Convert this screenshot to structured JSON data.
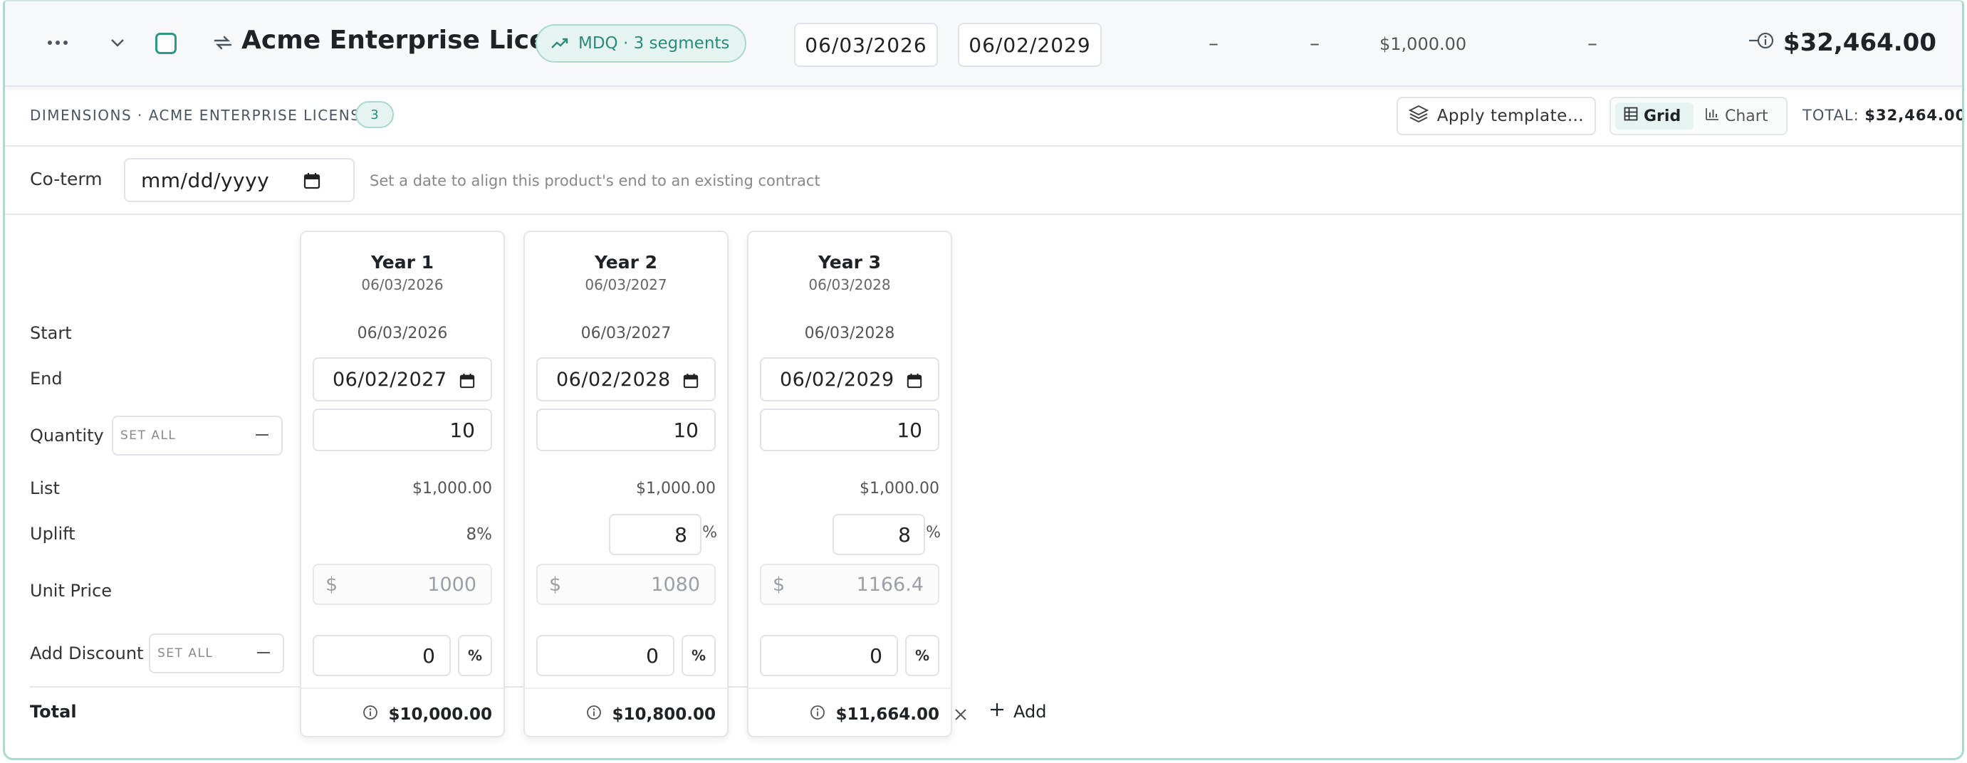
{
  "header": {
    "product_name": "Acme Enterprise License",
    "pill_label": "MDQ · 3 segments",
    "start_date": "06/03/2026",
    "end_date": "06/02/2029",
    "col_dash_1": "–",
    "col_dash_2": "–",
    "list_price": "$1,000.00",
    "col_dash_3": "–",
    "total": "$32,464.00",
    "icons": [
      "more-horizontal-icon",
      "chevron-down-icon",
      "repeat-icon",
      "trending-up-icon",
      "info-icon"
    ]
  },
  "dimensions": {
    "label": "DIMENSIONS · ACME ENTERPRISE LICENSE",
    "count": "3",
    "apply_template": "Apply template…",
    "view_grid": "Grid",
    "view_chart": "Chart",
    "active_view": "Grid",
    "total_label": "TOTAL:",
    "total_value": "$32,464.00"
  },
  "coterm": {
    "label": "Co-term",
    "placeholder": "mm/dd/yyyy",
    "hint": "Set a date to align this product's end to an existing contract"
  },
  "rows": {
    "start": "Start",
    "end": "End",
    "quantity": "Quantity",
    "list": "List",
    "uplift": "Uplift",
    "unit_price": "Unit Price",
    "add_discount": "Add Discount",
    "total": "Total",
    "set_all": "SET ALL"
  },
  "years": [
    {
      "title": "Year 1",
      "date": "06/03/2026",
      "start": "06/03/2026",
      "end": "06/02/2027",
      "quantity": "10",
      "list": "$1,000.00",
      "uplift": "8%",
      "uplift_editable": false,
      "unit_currency": "$",
      "unit_price": "1000",
      "discount": "0",
      "discount_unit": "%",
      "total": "$10,000.00"
    },
    {
      "title": "Year 2",
      "date": "06/03/2027",
      "start": "06/03/2027",
      "end": "06/02/2028",
      "quantity": "10",
      "list": "$1,000.00",
      "uplift": "8",
      "uplift_unit": "%",
      "uplift_editable": true,
      "unit_currency": "$",
      "unit_price": "1080",
      "discount": "0",
      "discount_unit": "%",
      "total": "$10,800.00"
    },
    {
      "title": "Year 3",
      "date": "06/03/2028",
      "start": "06/03/2028",
      "end": "06/02/2029",
      "quantity": "10",
      "list": "$1,000.00",
      "uplift": "8",
      "uplift_unit": "%",
      "uplift_editable": true,
      "unit_currency": "$",
      "unit_price": "1166.4",
      "discount": "0",
      "discount_unit": "%",
      "total": "$11,664.00"
    }
  ],
  "add_label": "Add",
  "colors": {
    "accent": "#2f9688",
    "accent_bg": "#e6f4f1",
    "border": "#dfe3e7"
  }
}
